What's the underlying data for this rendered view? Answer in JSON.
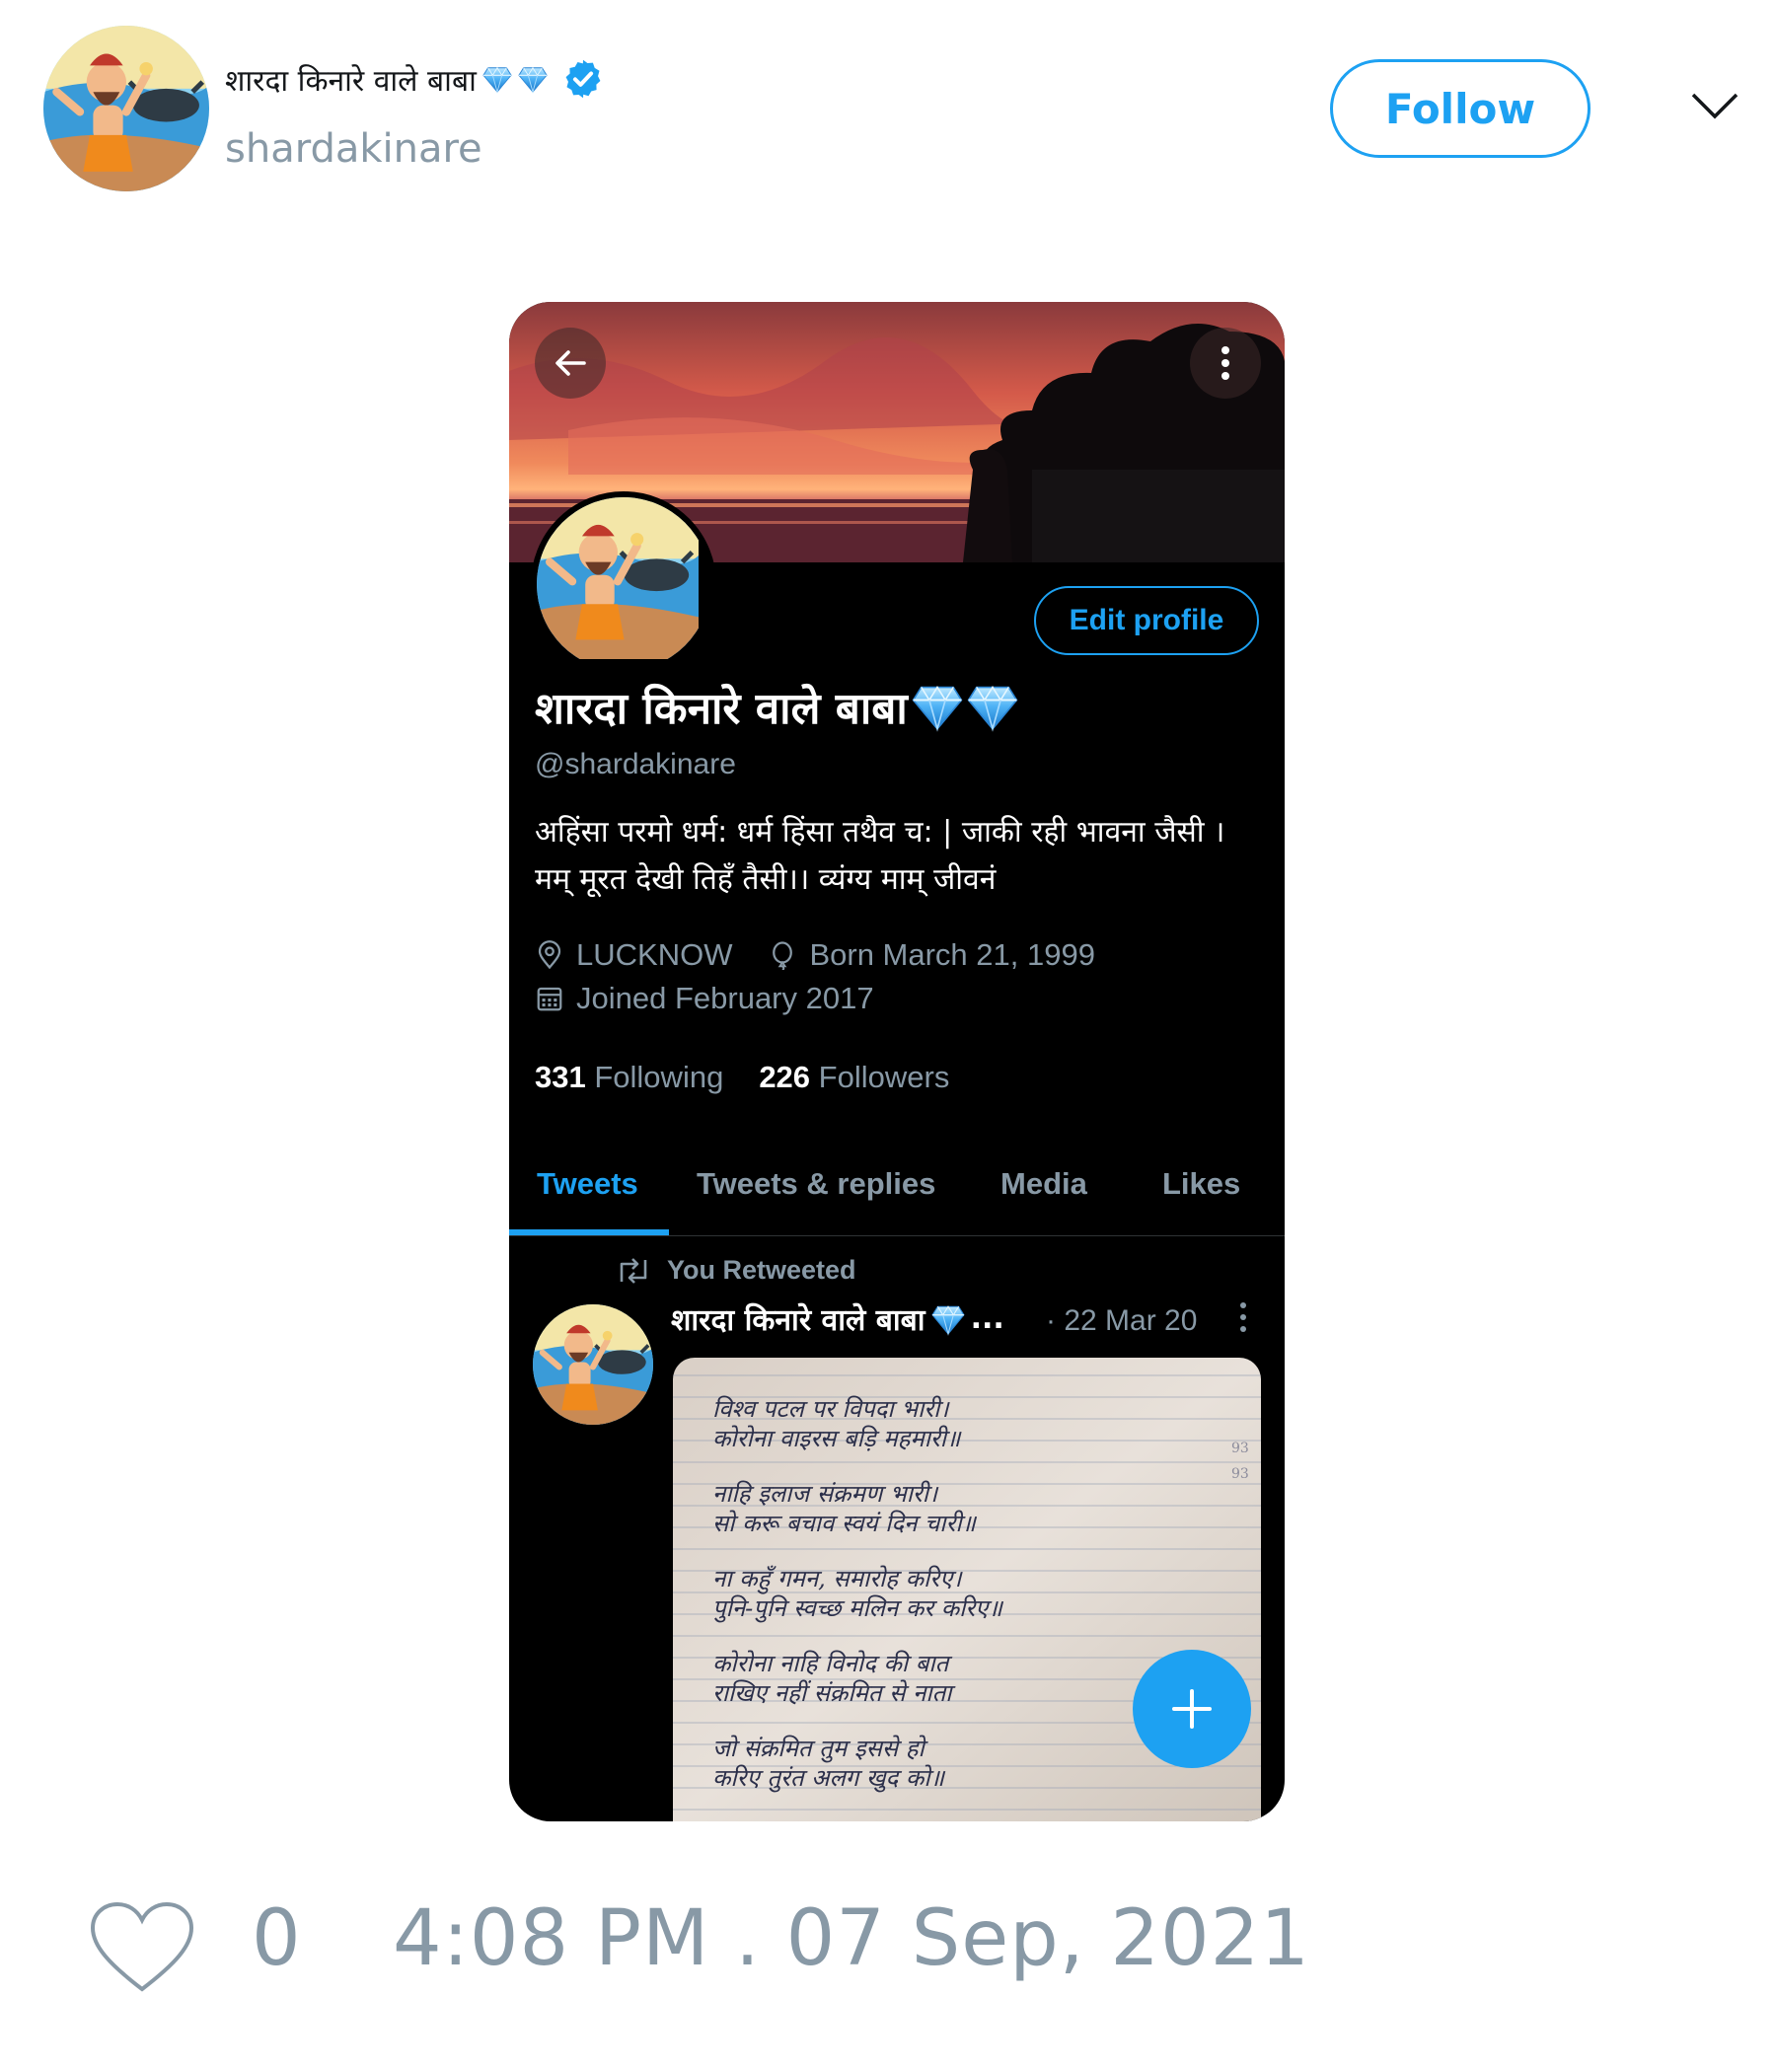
{
  "tweet_header": {
    "display_name": "शारदा किनारे वाले बाबा",
    "name_emojis": [
      "gem-stone",
      "gem-stone"
    ],
    "verified": true,
    "handle": "shardakinare",
    "follow_label": "Follow"
  },
  "screenshot": {
    "profile": {
      "edit_profile_label": "Edit profile",
      "name": "शारदा किनारे वाले बाबा",
      "handle": "@shardakinare",
      "bio_line1": "अहिंसा परमो धर्म: धर्म हिंसा तथैव च: | जाकी रही भावना जैसी ।",
      "bio_line2": "मम् मूरत देखी तिहँ तैसी।। व्यंग्य माम् जीवनं",
      "location": "LUCKNOW",
      "birth": "Born March 21, 1999",
      "joined": "Joined February 2017",
      "following_count": "331",
      "following_label": "Following",
      "followers_count": "226",
      "followers_label": "Followers"
    },
    "tabs": [
      {
        "label": "Tweets",
        "active": true
      },
      {
        "label": "Tweets & replies",
        "active": false
      },
      {
        "label": "Media",
        "active": false
      },
      {
        "label": "Likes",
        "active": false
      }
    ],
    "retweet": {
      "context": "You Retweeted",
      "name": "शारदा किनारे वाले बाबा",
      "truncation": "...",
      "date": "· 22 Mar 20",
      "image_lines": [
        "विश्व पटल पर विपदा भारी।",
        "कोरोना वाइरस बड़ि महमारी॥",
        "नाहि इलाज संक्रमण भारी।",
        "सो करू बचाव स्वयं दिन चारी॥",
        "ना कहुँ गमन, समारोह करिए।",
        "पुनि-पुनि स्वच्छ मलिन कर करिए॥",
        "कोरोना नाहि विनोद की बात",
        "राखिए नहीं संक्रमित से नाता",
        "जो संक्रमित तुम इससे हो",
        "करिए तुरंत अलग खुद को॥"
      ],
      "image_margin_numbers": [
        "93",
        "93"
      ]
    },
    "icons": {
      "back": "arrow-left-icon",
      "more": "more-vertical-icon",
      "location": "location-pin-icon",
      "birth": "balloon-icon",
      "joined": "calendar-icon",
      "retweet": "retweet-icon",
      "fab": "plus-icon"
    }
  },
  "footer": {
    "like_count": "0",
    "timestamp": "4:08 PM . 07 Sep, 2021"
  },
  "colors": {
    "accent": "#1da1f2",
    "muted": "#8899a6",
    "dark_bg": "#000000"
  }
}
